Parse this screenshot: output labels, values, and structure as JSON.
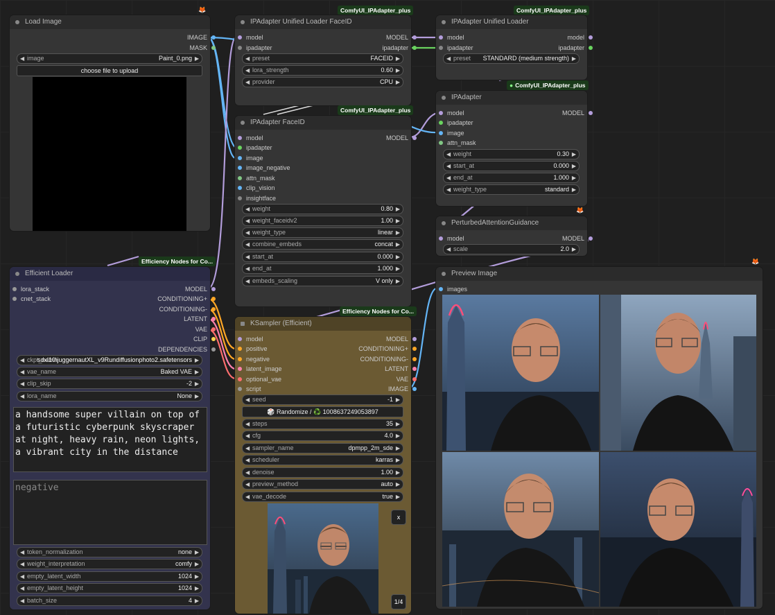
{
  "colors": {
    "model": "#b39ddb",
    "ipadapter": "#6ad45f",
    "image": "#64b5f6",
    "mask": "#81c784",
    "conditioning": "#ffa726",
    "latent": "#ff80ab",
    "vae": "#ff6e6e",
    "clip": "#ffd54f",
    "gray": "#999999"
  },
  "badges": {
    "ipadapter_plus": "ComfyUI_IPAdapter_plus",
    "efficiency": "Efficiency Nodes for Co..."
  },
  "load_image": {
    "title": "Load Image",
    "out_image": "IMAGE",
    "out_mask": "MASK",
    "image_label": "image",
    "image_value": "Paint_0.png",
    "upload": "choose file to upload"
  },
  "ipa_loader_faceid": {
    "title": "IPAdapter Unified Loader FaceID",
    "in_model": "model",
    "in_ipadapter": "ipadapter",
    "out_model": "MODEL",
    "out_ipadapter": "ipadapter",
    "preset_k": "preset",
    "preset_v": "FACEID",
    "lora_k": "lora_strength",
    "lora_v": "0.60",
    "provider_k": "provider",
    "provider_v": "CPU"
  },
  "ipa_loader": {
    "title": "IPAdapter Unified Loader",
    "in_model": "model",
    "in_ipadapter": "ipadapter",
    "out_model": "model",
    "out_ipadapter": "ipadapter",
    "preset_k": "preset",
    "preset_v": "STANDARD (medium strength)"
  },
  "ipa": {
    "title": "IPAdapter",
    "in_model": "model",
    "in_ipadapter": "ipadapter",
    "in_image": "image",
    "in_attn": "attn_mask",
    "out_model": "MODEL",
    "w1k": "weight",
    "w1v": "0.30",
    "w2k": "start_at",
    "w2v": "0.000",
    "w3k": "end_at",
    "w3v": "1.000",
    "w4k": "weight_type",
    "w4v": "standard"
  },
  "ipa_faceid": {
    "title": "IPAdapter FaceID",
    "in_model": "model",
    "in_ipadapter": "ipadapter",
    "in_image": "image",
    "in_image_neg": "image_negative",
    "in_attn": "attn_mask",
    "in_clip": "clip_vision",
    "in_insight": "insightface",
    "out_model": "MODEL",
    "w1k": "weight",
    "w1v": "0.80",
    "w2k": "weight_faceidv2",
    "w2v": "1.00",
    "w3k": "weight_type",
    "w3v": "linear",
    "w4k": "combine_embeds",
    "w4v": "concat",
    "w5k": "start_at",
    "w5v": "0.000",
    "w6k": "end_at",
    "w6v": "1.000",
    "w7k": "embeds_scaling",
    "w7v": "V only"
  },
  "pag": {
    "title": "PerturbedAttentionGuidance",
    "in_model": "model",
    "out_model": "MODEL",
    "scale_k": "scale",
    "scale_v": "2.0"
  },
  "eff_loader": {
    "title": "Efficient Loader",
    "in_lora": "lora_stack",
    "in_cnet": "cnet_stack",
    "out_model": "MODEL",
    "out_condp": "CONDITIONING+",
    "out_condn": "CONDITIONING-",
    "out_latent": "LATENT",
    "out_vae": "VAE",
    "out_clip": "CLIP",
    "out_dep": "DEPENDENCIES",
    "ckpt_k": "ckpt_name",
    "ckpt_v": "sdxl10\\juggernautXL_v9Rundiffusionphoto2.safetensors",
    "vae_k": "vae_name",
    "vae_v": "Baked VAE",
    "clip_k": "clip_skip",
    "clip_v": "-2",
    "lora_k": "lora_name",
    "lora_v": "None",
    "positive": "a handsome super villain on top of\na futuristic cyberpunk skyscraper\nat night, heavy rain, neon lights,\na vibrant city in the distance",
    "negative_ph": "negative",
    "tn_k": "token_normalization",
    "tn_v": "none",
    "wi_k": "weight_interpretation",
    "wi_v": "comfy",
    "ew_k": "empty_latent_width",
    "ew_v": "1024",
    "eh_k": "empty_latent_height",
    "eh_v": "1024",
    "bs_k": "batch_size",
    "bs_v": "4"
  },
  "ksampler": {
    "title": "KSampler (Efficient)",
    "in_model": "model",
    "in_pos": "positive",
    "in_neg": "negative",
    "in_latent": "latent_image",
    "in_vae": "optional_vae",
    "in_script": "script",
    "out_model": "MODEL",
    "out_condp": "CONDITIONING+",
    "out_condn": "CONDITIONING-",
    "out_latent": "LATENT",
    "out_vae": "VAE",
    "out_image": "IMAGE",
    "seed_k": "seed",
    "seed_v": "-1",
    "randomize": "🎲 Randomize / ♻️ 1008637249053897",
    "steps_k": "steps",
    "steps_v": "35",
    "cfg_k": "cfg",
    "cfg_v": "4.0",
    "sampler_k": "sampler_name",
    "sampler_v": "dpmpp_2m_sde",
    "sched_k": "scheduler",
    "sched_v": "karras",
    "denoise_k": "denoise",
    "denoise_v": "1.00",
    "pm_k": "preview_method",
    "pm_v": "auto",
    "vd_k": "vae_decode",
    "vd_v": "true",
    "close": "x",
    "counter": "1/4"
  },
  "preview": {
    "title": "Preview Image",
    "in_images": "images"
  }
}
